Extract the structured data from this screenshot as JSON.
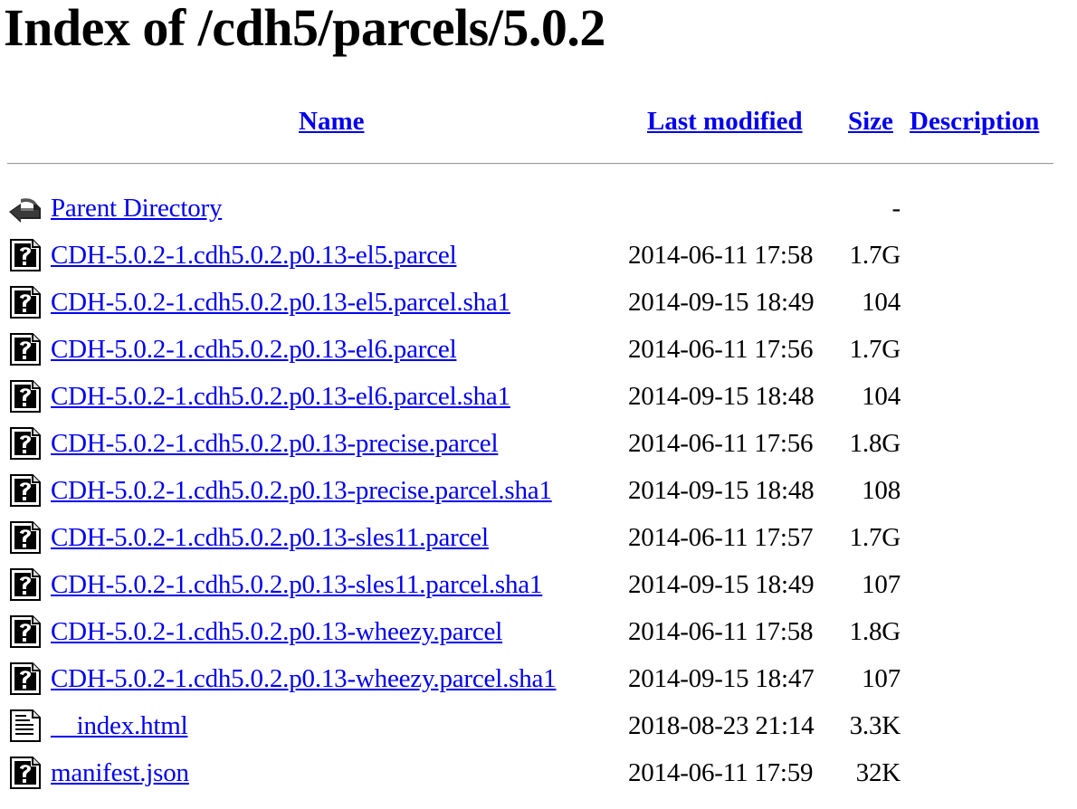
{
  "title": "Index of /cdh5/parcels/5.0.2",
  "columns": {
    "name": "Name",
    "last_modified": "Last modified",
    "size": "Size",
    "description": "Description"
  },
  "rows": [
    {
      "name": "Parent Directory",
      "modified": "",
      "size": "-",
      "icon": "parent-directory-icon"
    },
    {
      "name": "CDH-5.0.2-1.cdh5.0.2.p0.13-el5.parcel",
      "modified": "2014-06-11 17:58",
      "size": "1.7G",
      "icon": "unknown-file-icon"
    },
    {
      "name": "CDH-5.0.2-1.cdh5.0.2.p0.13-el5.parcel.sha1",
      "modified": "2014-09-15 18:49",
      "size": "104",
      "icon": "unknown-file-icon"
    },
    {
      "name": "CDH-5.0.2-1.cdh5.0.2.p0.13-el6.parcel",
      "modified": "2014-06-11 17:56",
      "size": "1.7G",
      "icon": "unknown-file-icon"
    },
    {
      "name": "CDH-5.0.2-1.cdh5.0.2.p0.13-el6.parcel.sha1",
      "modified": "2014-09-15 18:48",
      "size": "104",
      "icon": "unknown-file-icon"
    },
    {
      "name": "CDH-5.0.2-1.cdh5.0.2.p0.13-precise.parcel",
      "modified": "2014-06-11 17:56",
      "size": "1.8G",
      "icon": "unknown-file-icon"
    },
    {
      "name": "CDH-5.0.2-1.cdh5.0.2.p0.13-precise.parcel.sha1",
      "modified": "2014-09-15 18:48",
      "size": "108",
      "icon": "unknown-file-icon"
    },
    {
      "name": "CDH-5.0.2-1.cdh5.0.2.p0.13-sles11.parcel",
      "modified": "2014-06-11 17:57",
      "size": "1.7G",
      "icon": "unknown-file-icon"
    },
    {
      "name": "CDH-5.0.2-1.cdh5.0.2.p0.13-sles11.parcel.sha1",
      "modified": "2014-09-15 18:49",
      "size": "107",
      "icon": "unknown-file-icon"
    },
    {
      "name": "CDH-5.0.2-1.cdh5.0.2.p0.13-wheezy.parcel",
      "modified": "2014-06-11 17:58",
      "size": "1.8G",
      "icon": "unknown-file-icon"
    },
    {
      "name": "CDH-5.0.2-1.cdh5.0.2.p0.13-wheezy.parcel.sha1",
      "modified": "2014-09-15 18:47",
      "size": "107",
      "icon": "unknown-file-icon"
    },
    {
      "name": "__index.html",
      "modified": "2018-08-23 21:14",
      "size": "3.3K",
      "icon": "text-file-icon"
    },
    {
      "name": "manifest.json",
      "modified": "2014-06-11 17:59",
      "size": "32K",
      "icon": "unknown-file-icon"
    }
  ],
  "colors": {
    "link": "#0000ee",
    "text": "#000000",
    "rule": "#9a9a9a"
  }
}
